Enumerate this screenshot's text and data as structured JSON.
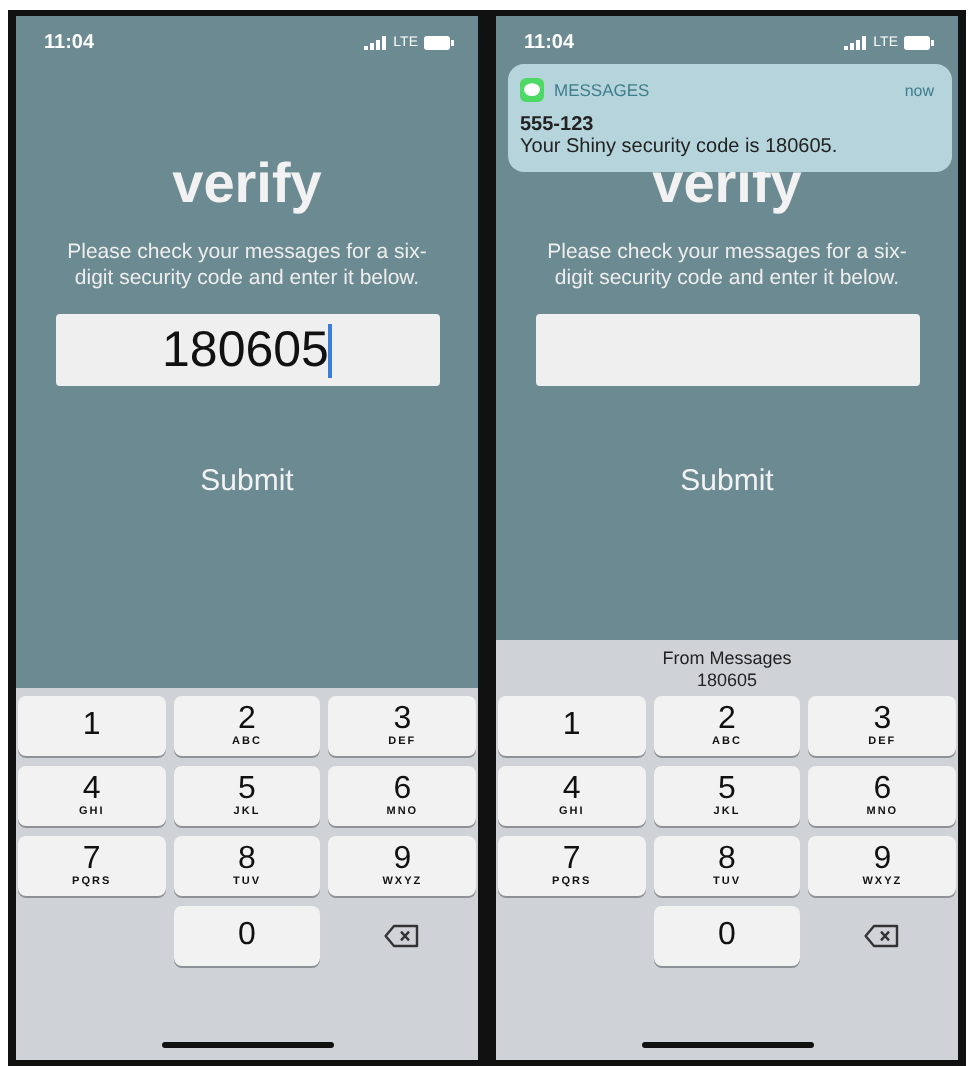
{
  "screens": [
    {
      "status_bar": {
        "time": "11:04",
        "network": "LTE"
      },
      "title": "verify",
      "instructions": "Please check your messages for a six-digit security code and enter it below.",
      "code_field": {
        "value": "180605",
        "focused": true
      },
      "submit": "Submit",
      "keypad": [
        {
          "kind": "digit",
          "digit": "1"
        },
        {
          "kind": "digit",
          "digit": "2",
          "letters": "ABC"
        },
        {
          "kind": "digit",
          "digit": "3",
          "letters": "DEF"
        },
        {
          "kind": "digit",
          "digit": "4",
          "letters": "GHI"
        },
        {
          "kind": "digit",
          "digit": "5",
          "letters": "JKL"
        },
        {
          "kind": "digit",
          "digit": "6",
          "letters": "MNO"
        },
        {
          "kind": "digit",
          "digit": "7",
          "letters": "PQRS"
        },
        {
          "kind": "digit",
          "digit": "8",
          "letters": "TUV"
        },
        {
          "kind": "digit",
          "digit": "9",
          "letters": "WXYZ"
        },
        {
          "kind": "blank"
        },
        {
          "kind": "digit",
          "digit": "0"
        },
        {
          "kind": "delete"
        }
      ]
    },
    {
      "status_bar": {
        "time": "11:04",
        "network": "LTE"
      },
      "title": "verify",
      "notification": {
        "app": "MESSAGES",
        "time": "now",
        "sender": "555-123",
        "message": "Your Shiny security code is 180605."
      },
      "instructions": "Please check your messages for a six-digit security code and enter it below.",
      "code_field": {
        "focused": false
      },
      "submit": "Submit",
      "suggestion": {
        "source": "From Messages",
        "code": "180605"
      },
      "keypad": [
        {
          "kind": "digit",
          "digit": "1"
        },
        {
          "kind": "digit",
          "digit": "2",
          "letters": "ABC"
        },
        {
          "kind": "digit",
          "digit": "3",
          "letters": "DEF"
        },
        {
          "kind": "digit",
          "digit": "4",
          "letters": "GHI"
        },
        {
          "kind": "digit",
          "digit": "5",
          "letters": "JKL"
        },
        {
          "kind": "digit",
          "digit": "6",
          "letters": "MNO"
        },
        {
          "kind": "digit",
          "digit": "7",
          "letters": "PQRS"
        },
        {
          "kind": "digit",
          "digit": "8",
          "letters": "TUV"
        },
        {
          "kind": "digit",
          "digit": "9",
          "letters": "WXYZ"
        },
        {
          "kind": "blank"
        },
        {
          "kind": "digit",
          "digit": "0"
        },
        {
          "kind": "delete"
        }
      ]
    }
  ]
}
